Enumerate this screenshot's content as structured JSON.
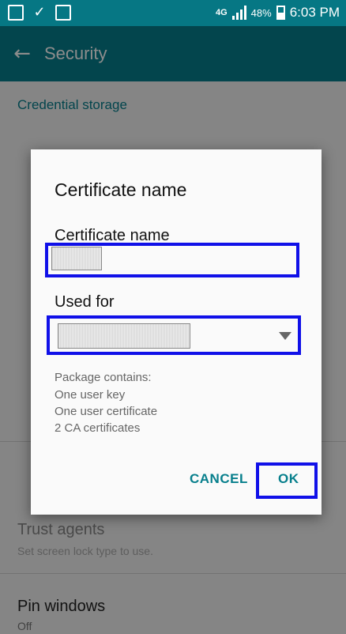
{
  "status_bar": {
    "network": "4G",
    "battery": "48%",
    "time": "6:03 PM",
    "icons": [
      "image-icon",
      "download-done-icon",
      "app-icon"
    ]
  },
  "app_bar": {
    "title": "Security",
    "back_icon": "arrow-back-icon"
  },
  "settings": {
    "credential_storage_header": "Credential storage",
    "trust_agents": {
      "title": "Trust agents",
      "subtitle": "Set screen lock type to use."
    },
    "pin_windows": {
      "title": "Pin windows",
      "subtitle": "Off"
    }
  },
  "dialog": {
    "title": "Certificate name",
    "name_label": "Certificate name",
    "used_for_label": "Used for",
    "package_contains": [
      "Package contains:",
      "One user key",
      "One user certificate",
      "2 CA certificates"
    ],
    "cancel_label": "CANCEL",
    "ok_label": "OK"
  },
  "colors": {
    "accent": "#077f8c",
    "highlight": "#1010e8"
  }
}
